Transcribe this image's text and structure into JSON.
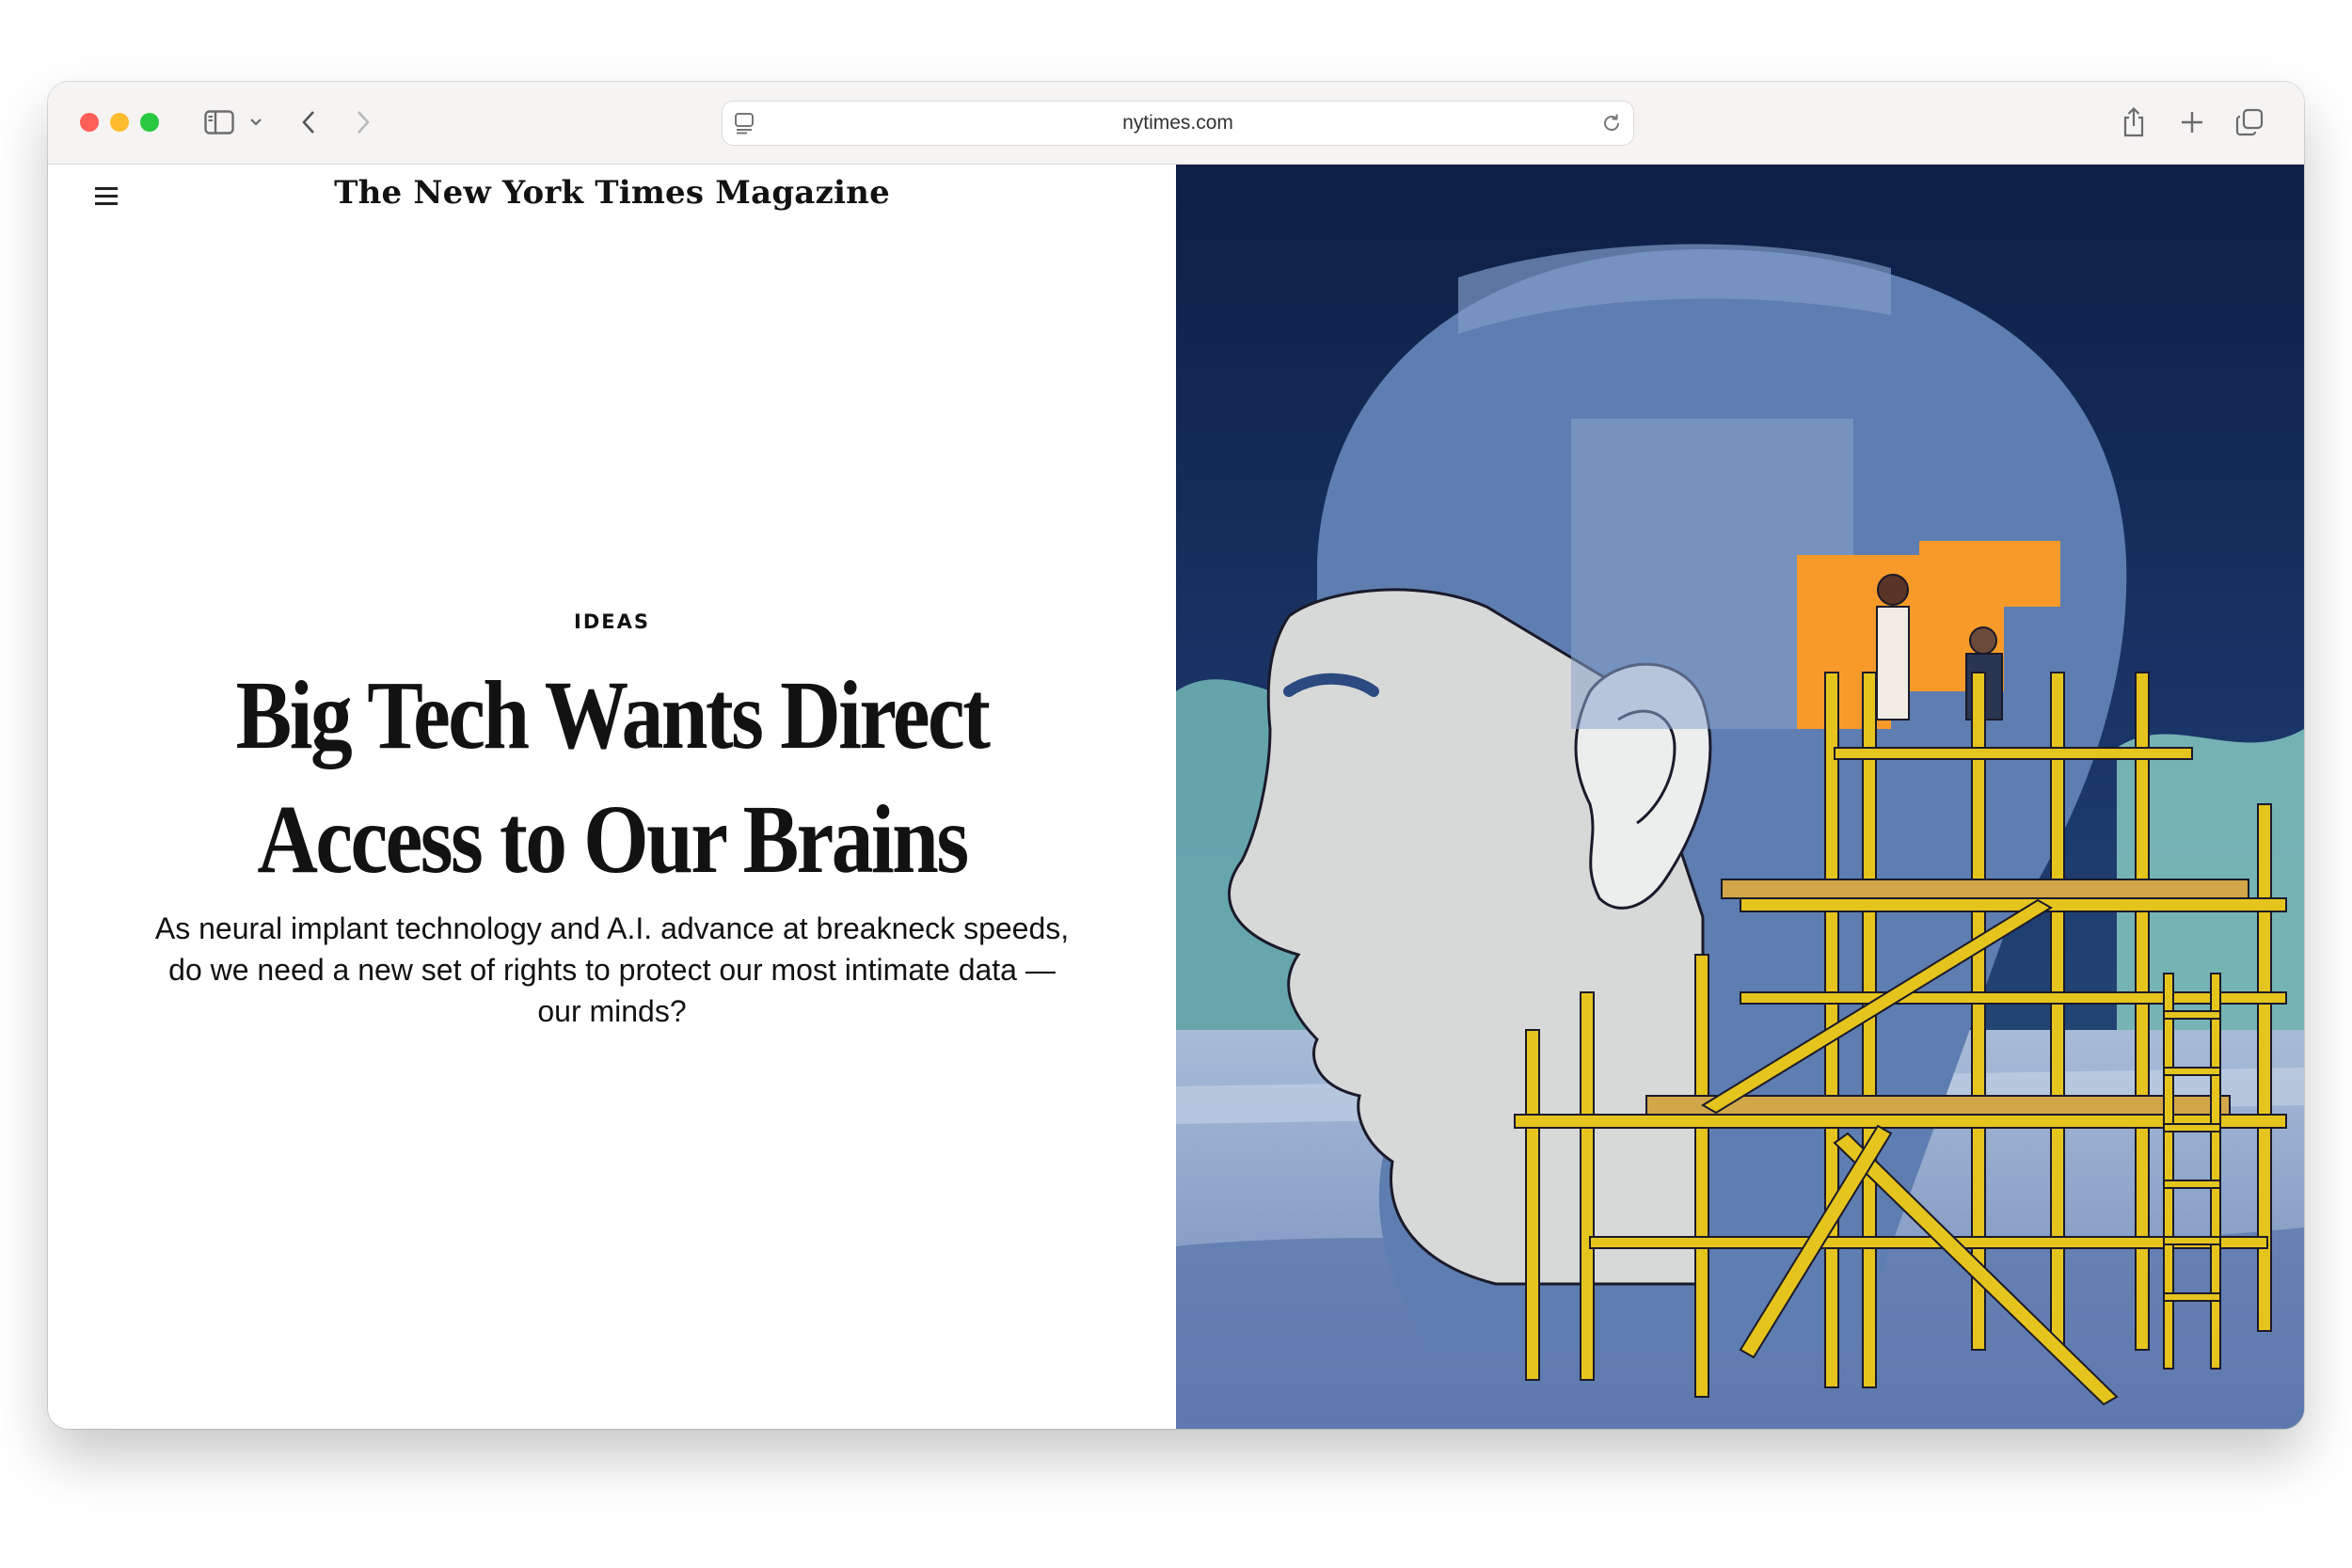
{
  "browser": {
    "url": "nytimes.com",
    "icons": [
      "sidebar-icon",
      "chevron-down-icon",
      "back-icon",
      "forward-icon",
      "page-icon",
      "reload-icon",
      "share-icon",
      "new-tab-icon",
      "tabs-overview-icon"
    ]
  },
  "header": {
    "masthead": "The New York Times Magazine",
    "menu_icon": "hamburger-icon"
  },
  "article": {
    "kicker": "IDEAS",
    "headline_line1": "Big Tech Wants Direct",
    "headline_line2": "Access to Our Brains",
    "dek": "As neural implant technology and A.I. advance at breakneck speeds, do we need a new set of rights to protect our most intimate data — our minds?"
  },
  "colors": {
    "traffic_red": "#fe5f57",
    "traffic_yellow": "#febc2e",
    "traffic_green": "#28c840",
    "illustration_sky": "#0f2348",
    "illustration_head": "#5e7db0",
    "illustration_face": "#d7d8d8",
    "illustration_scaffold": "#e6c41e",
    "illustration_window": "#f79a2a"
  }
}
